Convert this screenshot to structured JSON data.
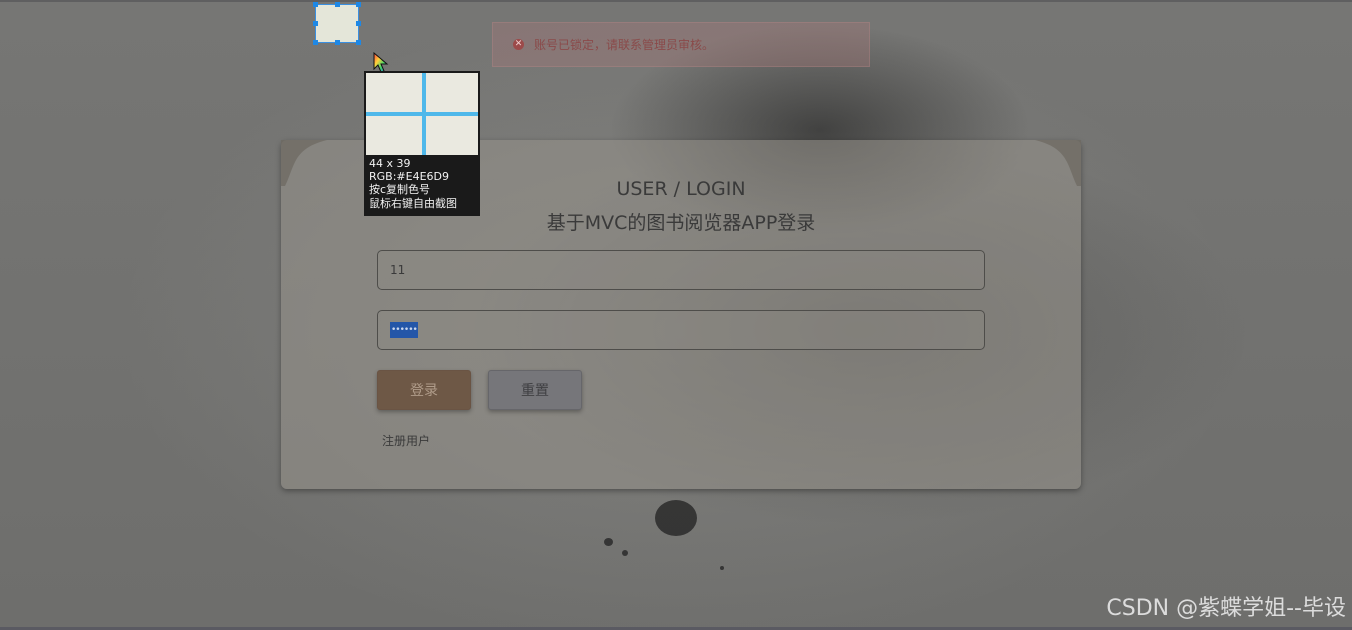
{
  "alert": {
    "message": "账号已锁定，请联系管理员审核。",
    "icon": "error-circle-icon"
  },
  "login": {
    "title": "USER / LOGIN",
    "subtitle": "基于MVC的图书阅览器APP登录",
    "username_value": "11",
    "password_mask": "••••••",
    "login_button": "登录",
    "reset_button": "重置",
    "register_link": "注册用户"
  },
  "screenshot_tool": {
    "size": "44 x 39",
    "rgb": "RGB:#E4E6D9",
    "hint_copy": "按c复制色号",
    "hint_capture": "鼠标右键自由截图"
  },
  "watermark": "CSDN @紫蝶学姐--毕设",
  "colors": {
    "sampled": "#E4E6D9",
    "accent_blue": "#4fb8ea",
    "login_button": "#6e5846"
  }
}
